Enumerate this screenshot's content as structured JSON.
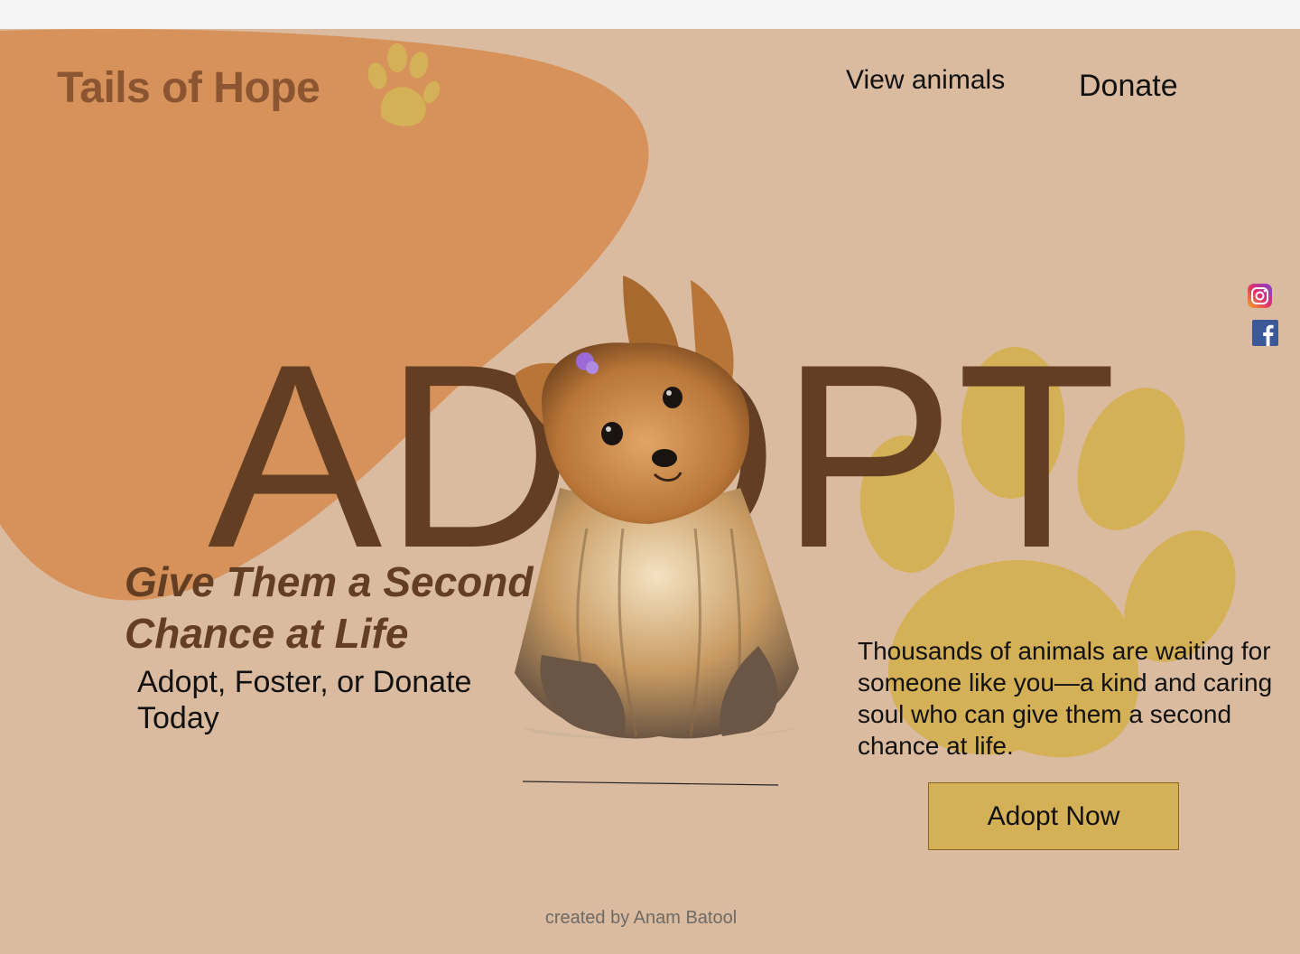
{
  "header": {
    "logo_text": "Tails of Hope",
    "nav": [
      {
        "label": "View animals"
      },
      {
        "label": "Donate"
      }
    ]
  },
  "social": [
    {
      "icon": "instagram-icon"
    },
    {
      "icon": "facebook-icon"
    }
  ],
  "hero": {
    "big_word": "ADOPT",
    "headline": "Give Them a Second Chance at Life",
    "subline": "Adopt, Foster, or Donate Today",
    "description": "Thousands of animals are waiting for someone like you—a kind and caring soul who can give them a second chance at life.",
    "cta_label": "Adopt Now"
  },
  "footer": {
    "credit": "created by Anam Batool"
  },
  "colors": {
    "background": "#dbbb9f",
    "blob": "#d6925a",
    "paw": "#d4b057",
    "brown_text": "#633e23",
    "logo_text": "#8a5530",
    "button": "#d4b057"
  }
}
